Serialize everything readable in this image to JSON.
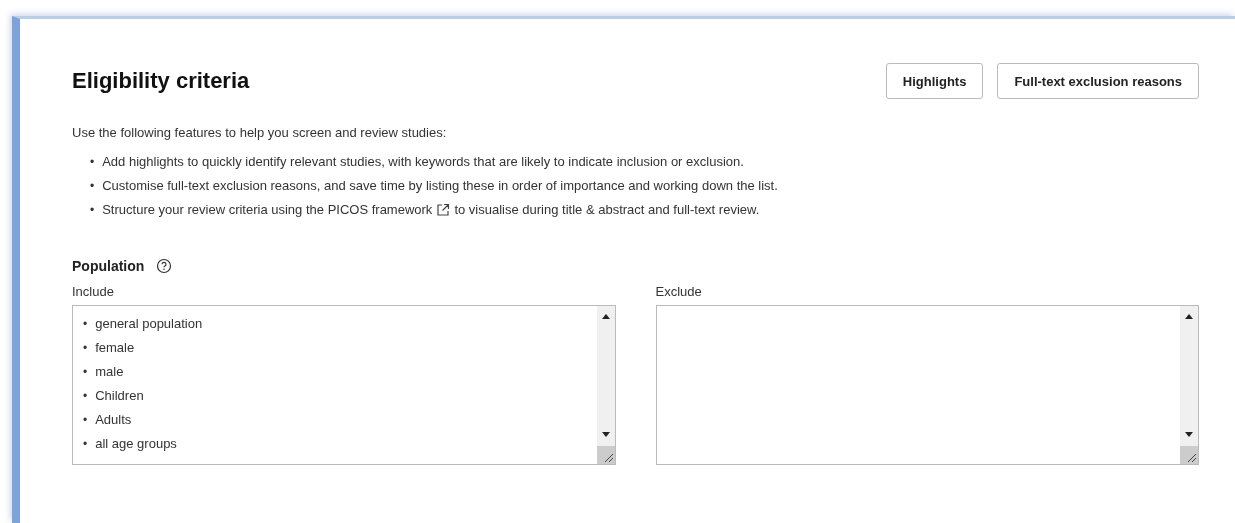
{
  "title": "Eligibility criteria",
  "buttons": [
    "Highlights",
    "Full-text exclusion reasons"
  ],
  "intro": "Use the following features to help you screen and review studies:",
  "bullet_marker": "•",
  "bullets": [
    {
      "text": "Add highlights to quickly identify relevant studies, with keywords that are likely to indicate inclusion or exclusion."
    },
    {
      "text": "Customise full-text exclusion reasons, and save time by listing these in order of importance and working down the list."
    },
    {
      "text": "Structure your review criteria using the PICOS framework",
      "external_link": true,
      "text_after": "to visualise during title & abstract and full-text review."
    }
  ],
  "section": {
    "title": "Population",
    "help": true,
    "fields": [
      {
        "label": "Include",
        "marker": "•",
        "items": [
          "general population",
          "female",
          "male",
          "Children",
          "Adults",
          "all age groups"
        ]
      },
      {
        "label": "Exclude"
      }
    ]
  }
}
